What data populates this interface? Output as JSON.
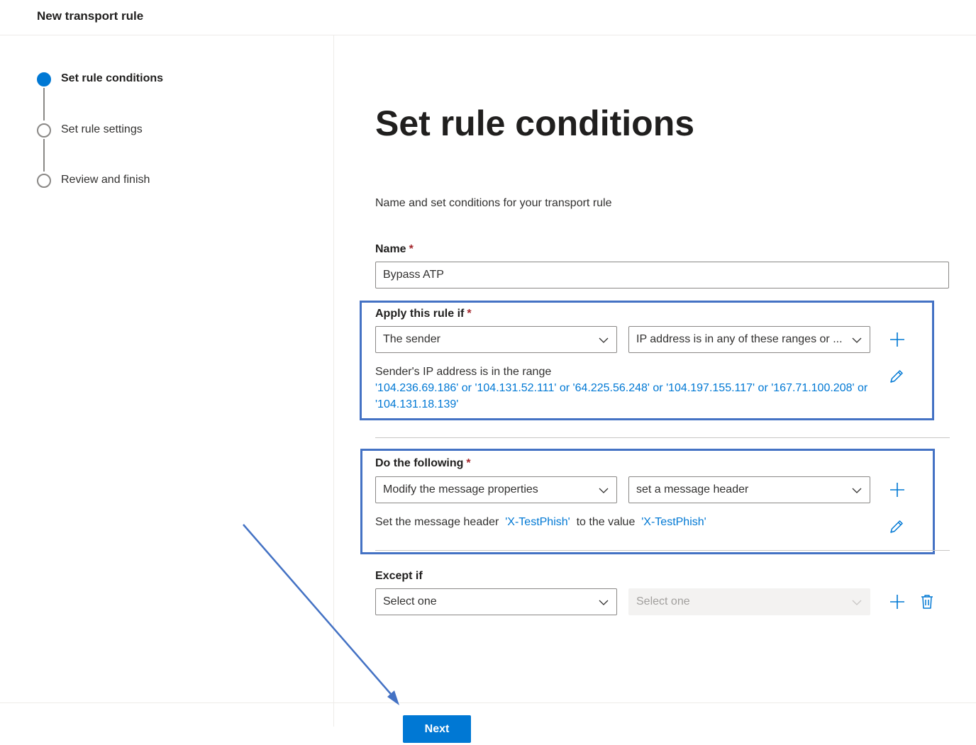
{
  "header": {
    "title": "New transport rule"
  },
  "steps": [
    {
      "label": "Set rule conditions",
      "state": "active"
    },
    {
      "label": "Set rule settings",
      "state": "pending"
    },
    {
      "label": "Review and finish",
      "state": "pending"
    }
  ],
  "main": {
    "title": "Set rule conditions",
    "subtitle": "Name and set conditions for your transport rule",
    "name": {
      "label": "Name",
      "required": "*",
      "value": "Bypass ATP"
    },
    "apply_rule": {
      "label": "Apply this rule if",
      "required": "*",
      "select1": "The sender",
      "select2": "IP address is in any of these ranges or ...",
      "summary_prefix": "Sender's IP address is in the range",
      "summary_line1": "'104.236.69.186' or '104.131.52.111' or '64.225.56.248' or '104.197.155.117' or '167.71.100.208' or",
      "summary_line2": "'104.131.18.139'"
    },
    "do_following": {
      "label": "Do the following",
      "required": "*",
      "select1": "Modify the message properties",
      "select2": "set a message header",
      "summary_part1": "Set the message header",
      "summary_header": "'X-TestPhish'",
      "summary_part2": "to the value",
      "summary_value": "'X-TestPhish'"
    },
    "except_if": {
      "label": "Except if",
      "select1": "Select one",
      "select2": "Select one"
    }
  },
  "footer": {
    "next_label": "Next"
  },
  "colors": {
    "accent": "#0078d4",
    "highlight": "#4472c4",
    "required": "#a4262c"
  }
}
